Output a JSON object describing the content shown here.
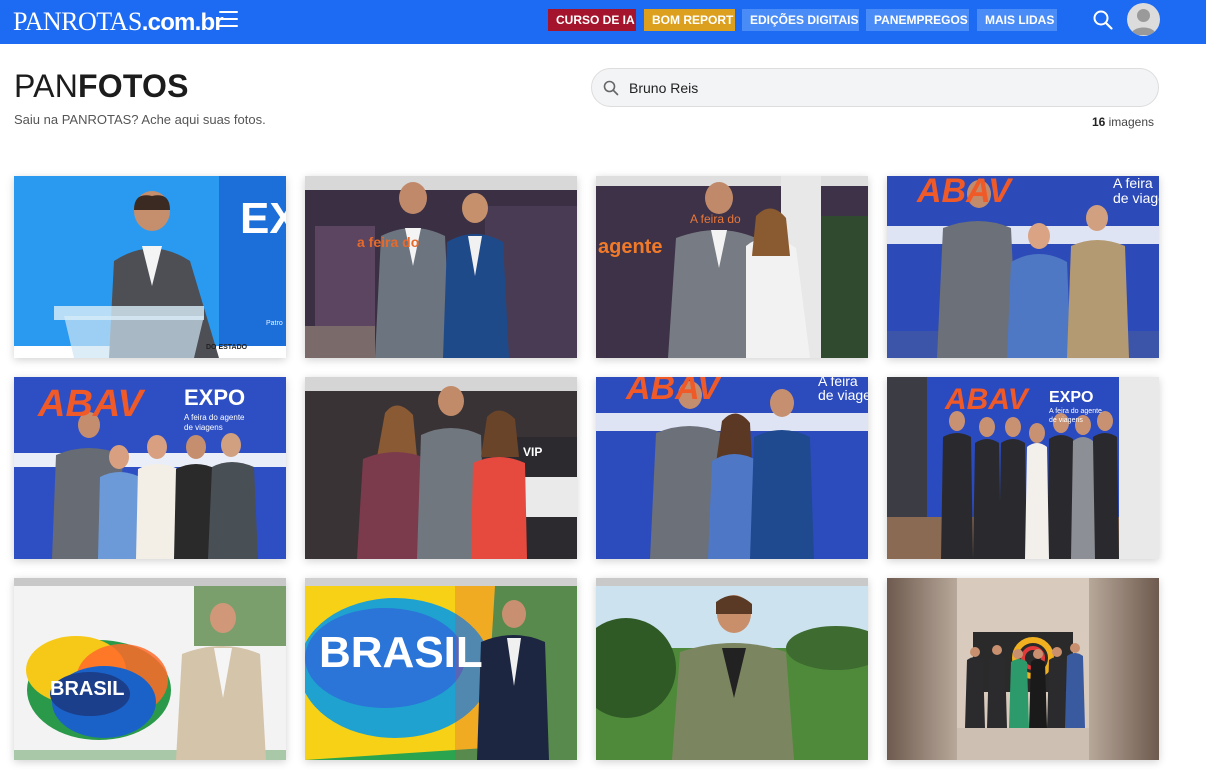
{
  "header": {
    "logo_main": "PANROTAS",
    "logo_domain": ".com.br",
    "nav": [
      {
        "label": "CURSO DE IA",
        "color": "#a4142c"
      },
      {
        "label": "BOM REPORT",
        "color": "#dca01e"
      },
      {
        "label": "EDIÇÕES DIGITAIS",
        "color": "#4a8cf7"
      },
      {
        "label": "PANEMPREGOS",
        "color": "#4a8cf7"
      },
      {
        "label": "MAIS LIDAS",
        "color": "#4a8cf7"
      }
    ],
    "bar_color": "#1d6bf3"
  },
  "page": {
    "title_light": "PAN",
    "title_bold": "FOTOS",
    "subtitle": "Saiu na PANROTAS? Ache aqui suas fotos."
  },
  "search": {
    "value": "Bruno Reis",
    "placeholder": ""
  },
  "results": {
    "count": "16",
    "unit": "imagens"
  },
  "photos": [
    {
      "caption_text": "EX",
      "extra_text": "DO ESTADO",
      "extra_text2": "Patro"
    },
    {
      "caption_text": "a feira do"
    },
    {
      "caption_text": "agente",
      "extra_text": "A feira do"
    },
    {
      "caption_text": "ABAV",
      "extra_text": "A feira",
      "extra_text2": "de viage"
    },
    {
      "caption_text": "ABAV",
      "extra_text": "EXPO",
      "extra_text2": "A feira do agente de viagens"
    },
    {
      "caption_text": "VIP"
    },
    {
      "caption_text": "ABAV",
      "extra_text": "A feira",
      "extra_text2": "de viage"
    },
    {
      "caption_text": "ABAV",
      "extra_text": "EXPO",
      "extra_text2": "A feira do agente de viagens"
    },
    {
      "caption_text": "BRASIL"
    },
    {
      "caption_text": "BRASIL"
    },
    {
      "caption_text": ""
    },
    {
      "caption_text": ""
    }
  ]
}
